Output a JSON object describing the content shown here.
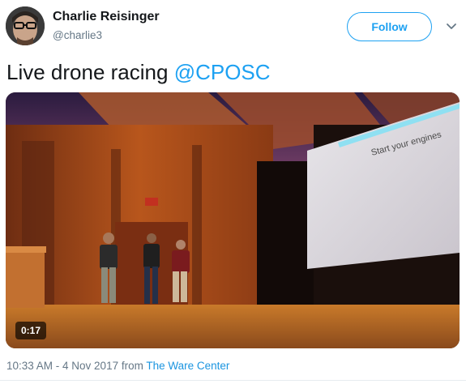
{
  "author": {
    "name": "Charlie Reisinger",
    "handle": "@charlie3"
  },
  "follow_button": {
    "label": "Follow"
  },
  "tweet": {
    "text": "Live drone racing ",
    "mention": "@CPOSC"
  },
  "media": {
    "type": "video",
    "duration": "0:17",
    "screen_text": "Start your engines"
  },
  "footer": {
    "timestamp": "10:33 AM - 4 Nov 2017",
    "from_label": " from ",
    "source": "The Ware Center"
  },
  "icons": {
    "caret": "chevron-down-icon"
  },
  "colors": {
    "accent": "#1da1f2",
    "text": "#14171a",
    "muted": "#657786"
  }
}
